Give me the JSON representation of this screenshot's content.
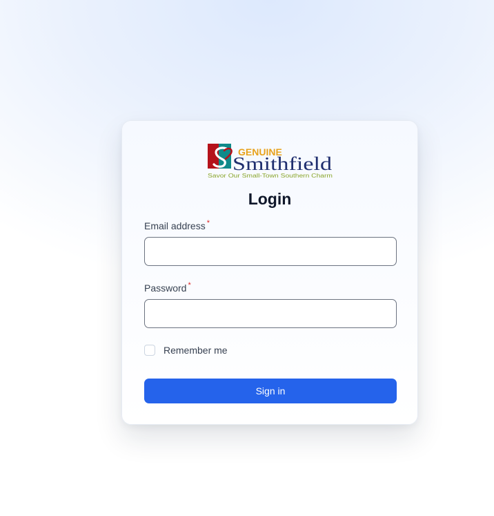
{
  "brand": {
    "logo_top": "GENUINE",
    "logo_main": "Smithfield",
    "logo_tagline": "Savor Our Small-Town Southern Charm",
    "logo_letter": "S"
  },
  "form": {
    "title": "Login",
    "email_label": "Email address",
    "email_value": "",
    "email_placeholder": "",
    "password_label": "Password",
    "password_value": "",
    "password_placeholder": "",
    "required_marker": "*",
    "remember_label": "Remember me",
    "remember_checked": false,
    "submit_label": "Sign in"
  },
  "colors": {
    "primary": "#2563eb",
    "logo_red": "#b5121b",
    "logo_teal": "#0e8a8a",
    "logo_navy": "#1f2e6e",
    "logo_gold": "#e8a21c",
    "logo_green": "#8aa52a"
  },
  "icons": {
    "checkbox": "checkbox-unchecked-icon"
  }
}
